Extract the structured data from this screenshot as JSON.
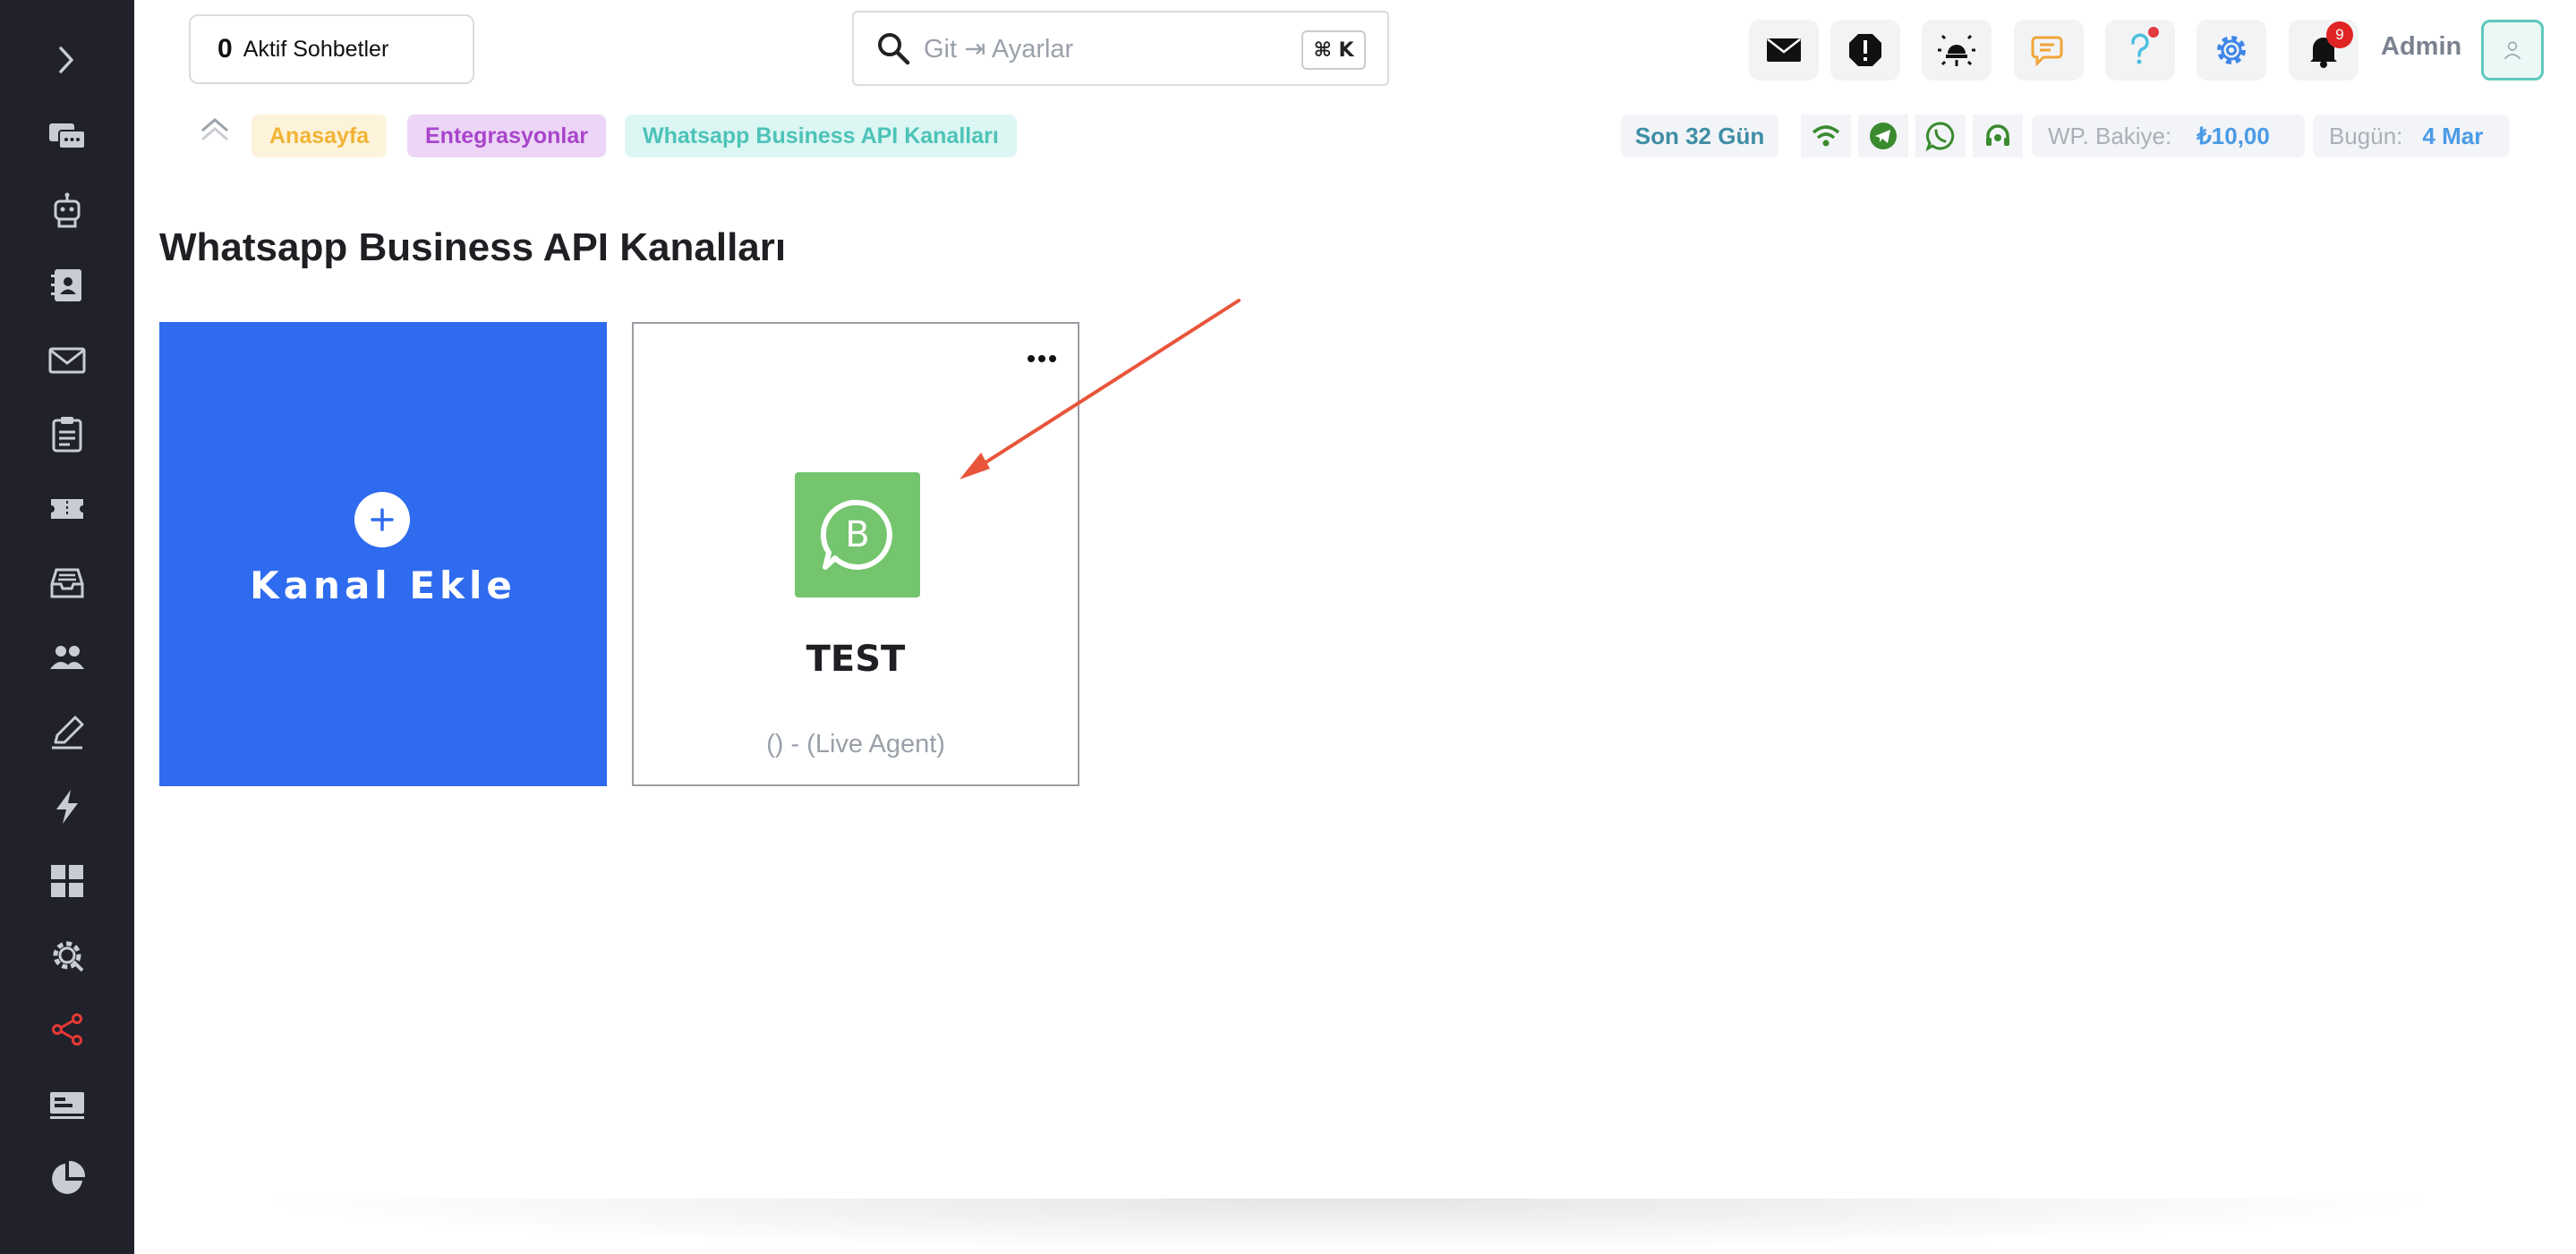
{
  "header": {
    "active_chats": {
      "count": "0",
      "label": "Aktif Sohbetler"
    },
    "search": {
      "placeholder": "Git ⇥ Ayarlar",
      "shortcut": "⌘ K"
    },
    "notifications": {
      "count": "9"
    },
    "user": {
      "name": "Admin"
    }
  },
  "breadcrumb": {
    "items": [
      {
        "label": "Anasayfa",
        "color": "#f1b434"
      },
      {
        "label": "Entegrasyonlar",
        "color": "#a845cc"
      },
      {
        "label": "Whatsapp Business API Kanalları",
        "color": "#4dc3b8"
      }
    ]
  },
  "stats": {
    "period": "Son 32 Gün",
    "wp_balance_label": "WP. Bakiye:",
    "wp_balance_value": "₺10,00",
    "today_label": "Bugün:",
    "today_value": "4 Mar"
  },
  "main": {
    "title": "Whatsapp Business API Kanalları",
    "add_card_label": "Kanal Ekle",
    "channels": [
      {
        "name": "TEST",
        "subtitle": "() - (Live Agent)",
        "logo": "whatsapp-business-icon"
      }
    ]
  },
  "colors": {
    "sidebar_bg": "#21212b",
    "accent_blue": "#2f6bef",
    "wa_green": "#74c56e",
    "active_nav": "#e53935"
  },
  "sidebar": {
    "items": [
      "chat-icon",
      "bot-icon",
      "contacts-icon",
      "mail-icon",
      "clipboard-icon",
      "ticket-icon",
      "inbox-icon",
      "users-icon",
      "edit-icon",
      "bolt-icon",
      "grid-icon",
      "settings-gear-icon",
      "share-icon",
      "cards-icon",
      "pie-chart-icon"
    ],
    "active": "share-icon"
  }
}
